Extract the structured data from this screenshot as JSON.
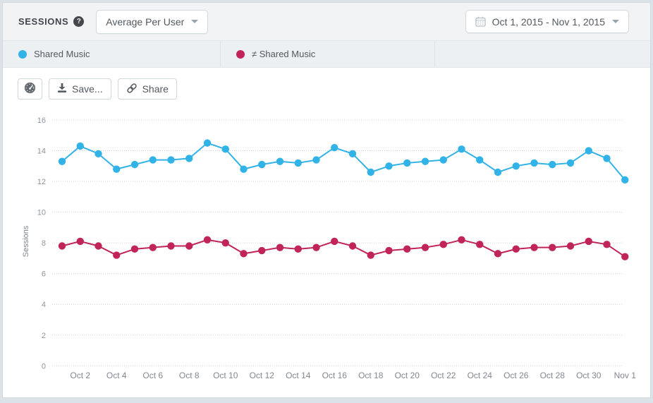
{
  "header": {
    "title": "SESSIONS",
    "help_icon": "question-circle-icon",
    "metric_dropdown": {
      "value": "Average Per User",
      "icon": "chevron-down-icon"
    },
    "date_range_dropdown": {
      "value": "Oct 1, 2015 - Nov 1, 2015",
      "icon": "calendar-icon"
    }
  },
  "legend": {
    "items": [
      {
        "label": "Shared Music",
        "color": "#31b3e7"
      },
      {
        "label": "≠ Shared Music",
        "color": "#c02459"
      }
    ]
  },
  "toolbar": {
    "dashboard_button_icon": "gauge-icon",
    "save_label": "Save...",
    "save_icon": "download-icon",
    "share_label": "Share",
    "share_icon": "link-icon"
  },
  "chart_data": {
    "type": "line",
    "title": "",
    "xlabel": "",
    "ylabel": "Sessions",
    "ylim": [
      0,
      16
    ],
    "yticks": [
      0,
      2,
      4,
      6,
      8,
      10,
      12,
      14,
      16
    ],
    "grid": "horizontal-dotted",
    "legend_position": "top",
    "x": [
      "Oct 1",
      "Oct 2",
      "Oct 3",
      "Oct 4",
      "Oct 5",
      "Oct 6",
      "Oct 7",
      "Oct 8",
      "Oct 9",
      "Oct 10",
      "Oct 11",
      "Oct 12",
      "Oct 13",
      "Oct 14",
      "Oct 15",
      "Oct 16",
      "Oct 17",
      "Oct 18",
      "Oct 19",
      "Oct 20",
      "Oct 21",
      "Oct 22",
      "Oct 23",
      "Oct 24",
      "Oct 25",
      "Oct 26",
      "Oct 27",
      "Oct 28",
      "Oct 29",
      "Oct 30",
      "Oct 31",
      "Nov 1"
    ],
    "x_tick_labels": [
      "Oct 2",
      "Oct 4",
      "Oct 6",
      "Oct 8",
      "Oct 10",
      "Oct 12",
      "Oct 14",
      "Oct 16",
      "Oct 18",
      "Oct 20",
      "Oct 22",
      "Oct 24",
      "Oct 26",
      "Oct 28",
      "Oct 30",
      "Nov 1"
    ],
    "series": [
      {
        "name": "Shared Music",
        "color": "#31b3e7",
        "values": [
          13.3,
          14.3,
          13.8,
          12.8,
          13.1,
          13.4,
          13.4,
          13.5,
          14.5,
          14.1,
          12.8,
          13.1,
          13.3,
          13.2,
          13.4,
          14.2,
          13.8,
          12.6,
          13.0,
          13.2,
          13.3,
          13.4,
          14.1,
          13.4,
          12.6,
          13.0,
          13.2,
          13.1,
          13.2,
          14.0,
          13.5,
          12.1
        ]
      },
      {
        "name": "≠ Shared Music",
        "color": "#c02459",
        "values": [
          7.8,
          8.1,
          7.8,
          7.2,
          7.6,
          7.7,
          7.8,
          7.8,
          8.2,
          8.0,
          7.3,
          7.5,
          7.7,
          7.6,
          7.7,
          8.1,
          7.8,
          7.2,
          7.5,
          7.6,
          7.7,
          7.9,
          8.2,
          7.9,
          7.3,
          7.6,
          7.7,
          7.7,
          7.8,
          8.1,
          7.9,
          7.1
        ]
      }
    ]
  }
}
